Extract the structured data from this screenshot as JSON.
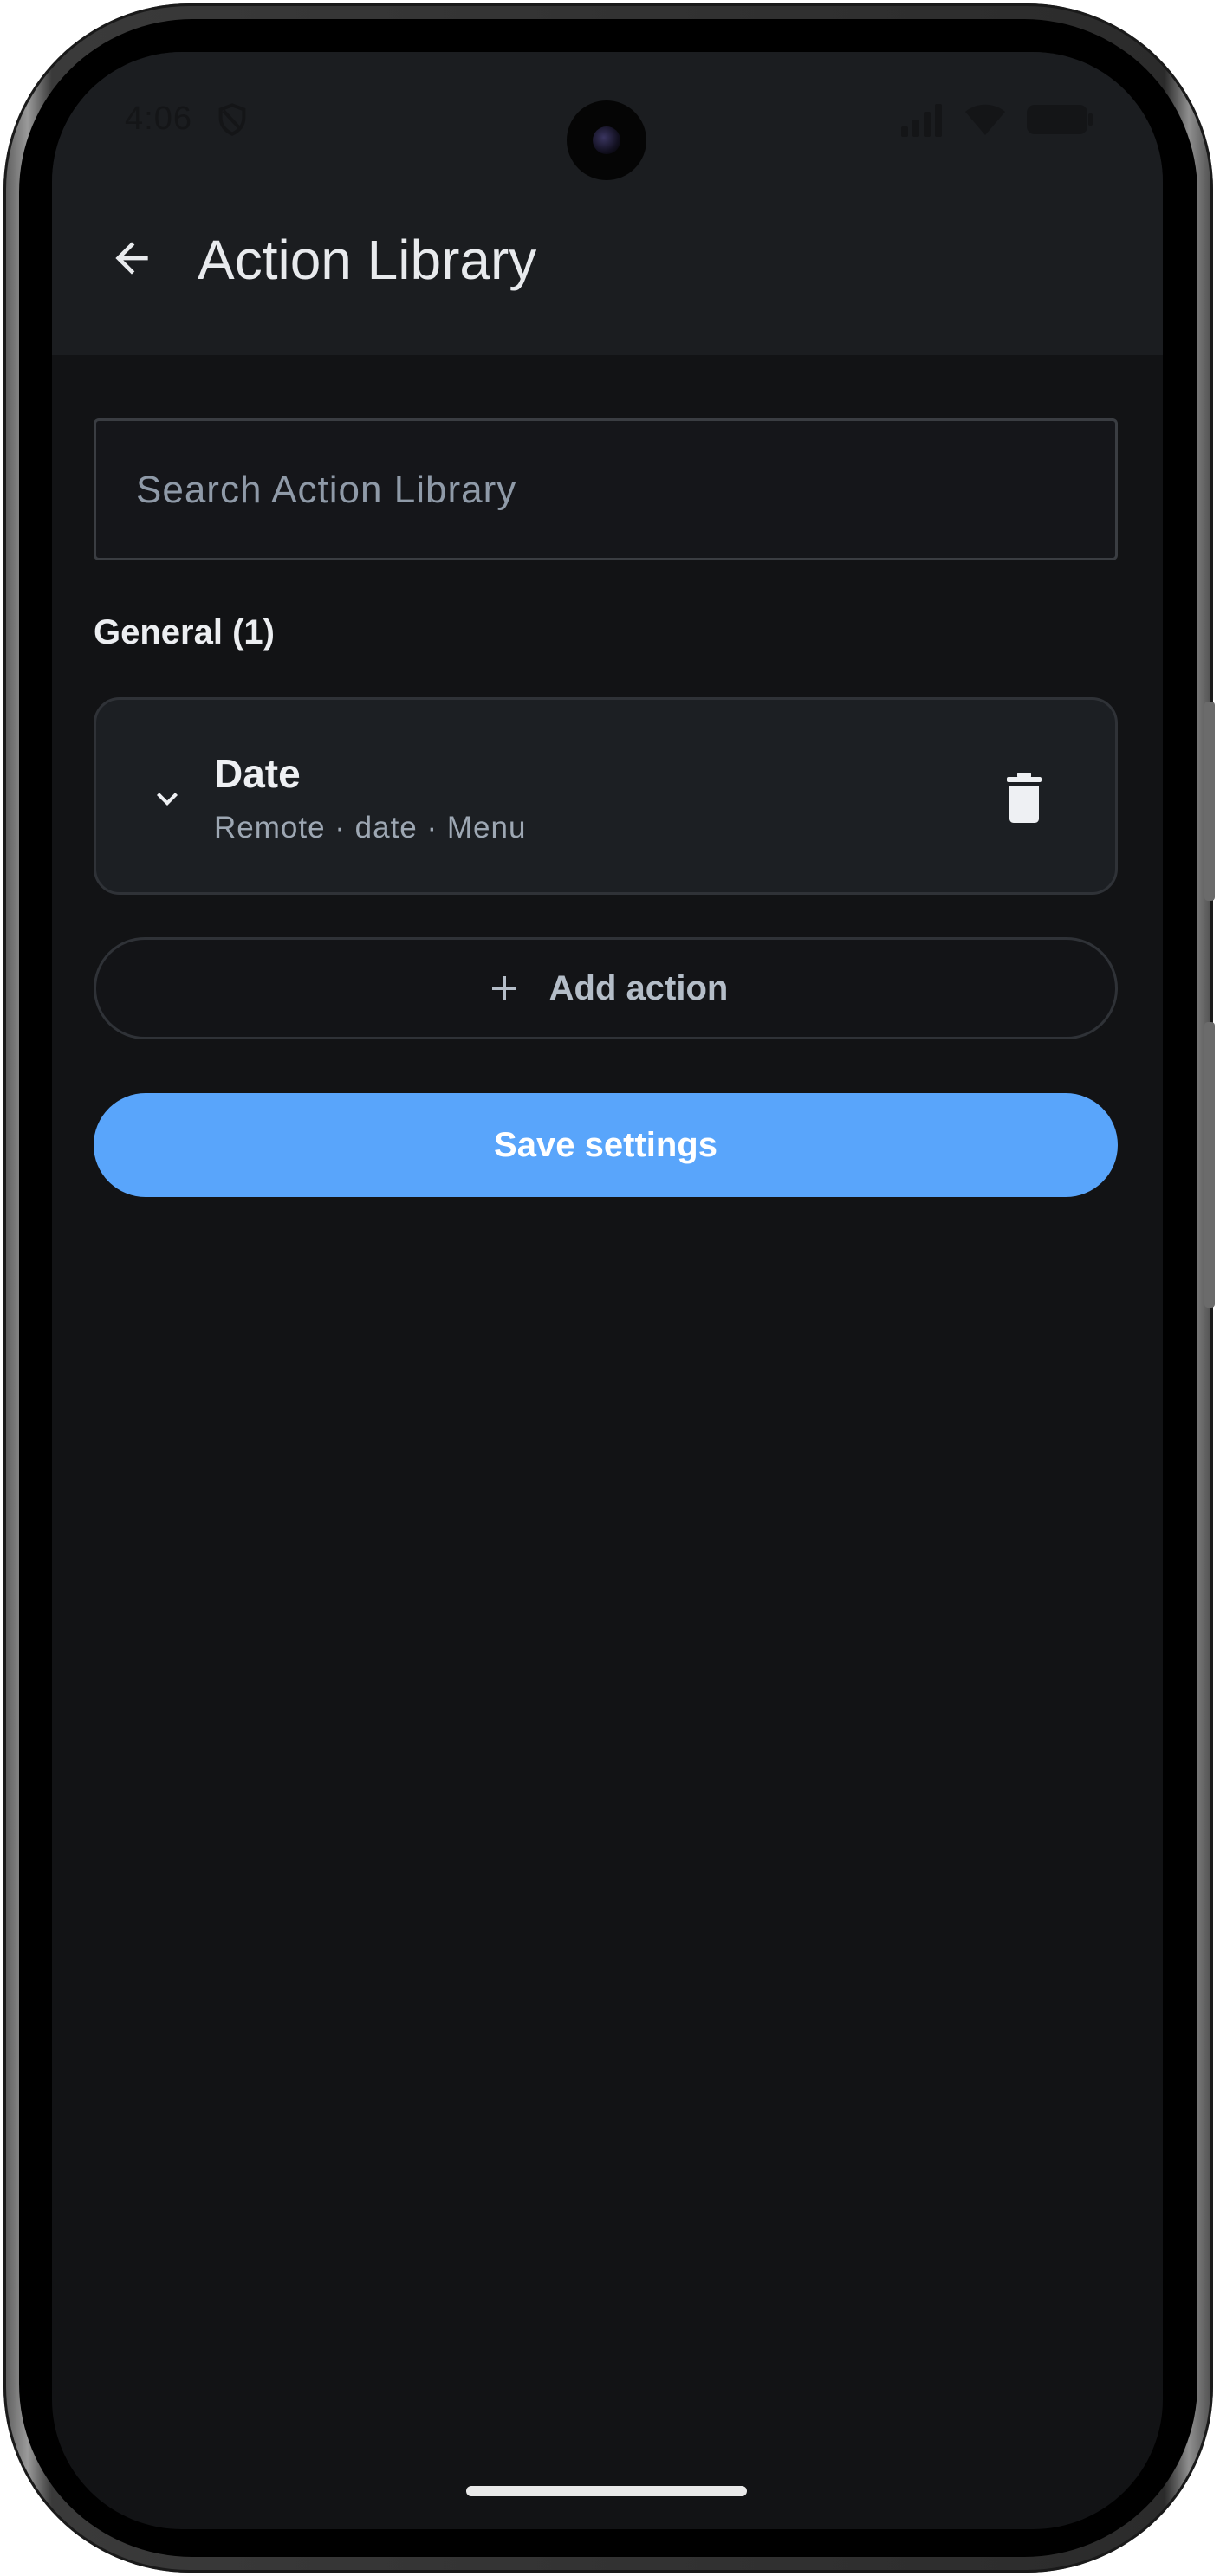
{
  "status_bar": {
    "time": "4:06",
    "icons": [
      "shield-icon",
      "signal-icon",
      "wifi-icon",
      "battery-icon"
    ]
  },
  "header": {
    "back_icon": "arrow-left-icon",
    "title": "Action Library"
  },
  "search": {
    "placeholder": "Search Action Library",
    "value": ""
  },
  "section": {
    "label": "General (1)"
  },
  "actions": [
    {
      "name": "Date",
      "meta": "Remote · date · Menu",
      "expand_icon": "chevron-down-icon",
      "delete_icon": "trash-icon"
    }
  ],
  "buttons": {
    "add_action_label": "Add action",
    "add_icon": "plus-icon",
    "save_label": "Save settings"
  },
  "colors": {
    "background": "#121315",
    "app_bar": "#1b1d20",
    "card": "#1c1f23",
    "primary": "#59a5fb",
    "muted_text": "#9da7b3"
  }
}
